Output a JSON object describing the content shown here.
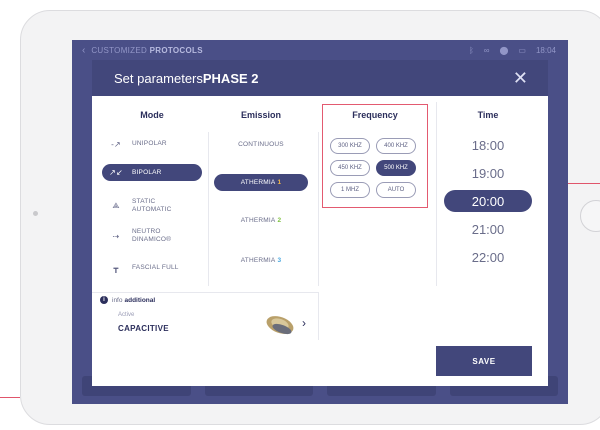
{
  "status": {
    "back_glyph": "‹",
    "title_prefix": "CUSTOMIZED",
    "title_bold": "PROTOCOLS",
    "time": "18:04",
    "icons": [
      "bluetooth-icon",
      "link-icon",
      "location-icon",
      "battery-icon"
    ]
  },
  "modal": {
    "title_prefix": "Set parameters",
    "title_bold": "PHASE 2",
    "close_glyph": "✕"
  },
  "columns": {
    "mode": "Mode",
    "emission": "Emission",
    "frequency": "Frequency",
    "time": "Time"
  },
  "modes": [
    {
      "label": "UNIPOLAR",
      "icon": "unipolar-icon",
      "glyph": "-↗",
      "active": false
    },
    {
      "label": "BIPOLAR",
      "icon": "bipolar-icon",
      "glyph": "↗↙",
      "active": true
    },
    {
      "label": "STATIC AUTOMATIC",
      "icon": "static-automatic-icon",
      "glyph": "⟁",
      "active": false
    },
    {
      "label": "NEUTRO DINAMICO®",
      "icon": "neutro-dinamico-icon",
      "glyph": "⇢",
      "active": false
    },
    {
      "label": "FASCIAL FULL",
      "icon": "fascial-full-icon",
      "glyph": "┳",
      "active": false
    }
  ],
  "emissions": [
    {
      "label": "CONTINUOUS",
      "number": "",
      "active": false
    },
    {
      "label": "ATHERMIA",
      "number": "1",
      "number_color": "#f0b64a",
      "active": true
    },
    {
      "label": "ATHERMIA",
      "number": "2",
      "number_color": "#7fc241",
      "active": false
    },
    {
      "label": "ATHERMIA",
      "number": "3",
      "number_color": "#4aa8e0",
      "active": false
    }
  ],
  "frequencies": [
    {
      "label": "300 KHZ",
      "active": false
    },
    {
      "label": "400 KHZ",
      "active": false
    },
    {
      "label": "450 KHZ",
      "active": false
    },
    {
      "label": "500 KHZ",
      "active": true
    },
    {
      "label": "1 MHZ",
      "active": false
    },
    {
      "label": "AUTO",
      "active": false
    }
  ],
  "times": [
    {
      "label": "18:00",
      "active": false
    },
    {
      "label": "19:00",
      "active": false
    },
    {
      "label": "20:00",
      "active": true
    },
    {
      "label": "21:00",
      "active": false
    },
    {
      "label": "22:00",
      "active": false
    }
  ],
  "info": {
    "icon_glyph": "i",
    "prefix": "info",
    "bold": "additional",
    "active_label": "Active",
    "active_value": "CAPACITIVE",
    "chevron": "›"
  },
  "save_label": "SAVE",
  "colors": {
    "accent": "#42477b",
    "highlight": "#e35a70",
    "screen_bg": "#4a4f87"
  }
}
